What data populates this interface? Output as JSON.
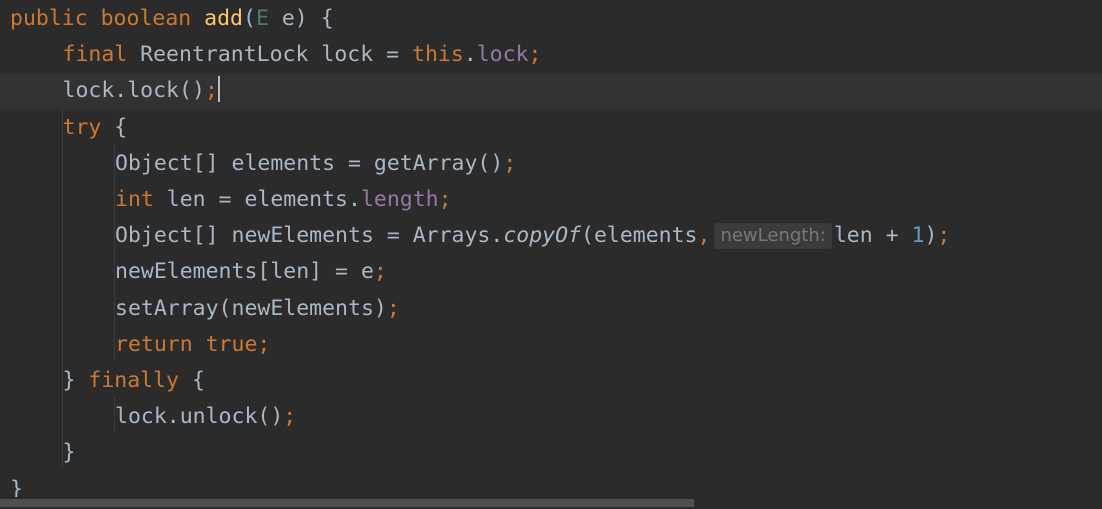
{
  "editor": {
    "language": "Java",
    "lines": [
      {
        "indent": 0,
        "tokens": [
          {
            "t": "public boolean ",
            "c": "kw"
          },
          {
            "t": "add",
            "c": "fn"
          },
          {
            "t": "(",
            "c": ""
          },
          {
            "t": "E",
            "c": "tp"
          },
          {
            "t": " e) {",
            "c": ""
          }
        ]
      },
      {
        "indent": 1,
        "tokens": [
          {
            "t": "final ",
            "c": "kw"
          },
          {
            "t": "ReentrantLock lock = ",
            "c": ""
          },
          {
            "t": "this",
            "c": "kw"
          },
          {
            "t": ".",
            "c": ""
          },
          {
            "t": "lock",
            "c": "fld"
          },
          {
            "t": ";",
            "c": "kw"
          }
        ]
      },
      {
        "indent": 1,
        "current": true,
        "tokens": [
          {
            "t": "lock.lock()",
            "c": ""
          },
          {
            "t": ";",
            "c": "kw"
          },
          {
            "caret": true
          }
        ]
      },
      {
        "indent": 1,
        "tokens": [
          {
            "t": "try ",
            "c": "kw"
          },
          {
            "t": "{",
            "c": ""
          }
        ]
      },
      {
        "indent": 2,
        "tokens": [
          {
            "t": "Object[] elements = getArray()",
            "c": ""
          },
          {
            "t": ";",
            "c": "kw"
          }
        ]
      },
      {
        "indent": 2,
        "tokens": [
          {
            "t": "int ",
            "c": "kw"
          },
          {
            "t": "len = elements.",
            "c": ""
          },
          {
            "t": "length",
            "c": "fld"
          },
          {
            "t": ";",
            "c": "kw"
          }
        ]
      },
      {
        "indent": 2,
        "tokens": [
          {
            "t": "Object[] newElements = Arrays.",
            "c": ""
          },
          {
            "t": "copyOf",
            "c": "it"
          },
          {
            "t": "(elements",
            "c": ""
          },
          {
            "t": ",",
            "c": "kw"
          },
          {
            "hint": "newLength:"
          },
          {
            "t": "len + ",
            "c": ""
          },
          {
            "t": "1",
            "c": "num"
          },
          {
            "t": ")",
            "c": ""
          },
          {
            "t": ";",
            "c": "kw"
          }
        ]
      },
      {
        "indent": 2,
        "tokens": [
          {
            "t": "newElements[len] = e",
            "c": ""
          },
          {
            "t": ";",
            "c": "kw"
          }
        ]
      },
      {
        "indent": 2,
        "tokens": [
          {
            "t": "setArray(newElements)",
            "c": ""
          },
          {
            "t": ";",
            "c": "kw"
          }
        ]
      },
      {
        "indent": 2,
        "tokens": [
          {
            "t": "return true;",
            "c": "kw"
          }
        ]
      },
      {
        "indent": 1,
        "tokens": [
          {
            "t": "} ",
            "c": ""
          },
          {
            "t": "finally ",
            "c": "kw"
          },
          {
            "t": "{",
            "c": ""
          }
        ]
      },
      {
        "indent": 2,
        "tokens": [
          {
            "t": "lock.unlock()",
            "c": ""
          },
          {
            "t": ";",
            "c": "kw"
          }
        ]
      },
      {
        "indent": 1,
        "tokens": [
          {
            "t": "}",
            "c": ""
          }
        ]
      },
      {
        "indent": 0,
        "tokens": [
          {
            "t": "}",
            "c": ""
          }
        ]
      }
    ]
  },
  "colors": {
    "background": "#2b2b2b",
    "current_line": "#323232",
    "keyword": "#cc7832",
    "method": "#ffc66d",
    "type_param": "#507874",
    "field": "#9876aa",
    "number": "#6897bb",
    "text": "#a9b7c6",
    "hint_bg": "#3b3b3b",
    "hint_text": "#787878"
  },
  "scrollbar": {
    "horizontal_visible_fraction": 0.63
  }
}
